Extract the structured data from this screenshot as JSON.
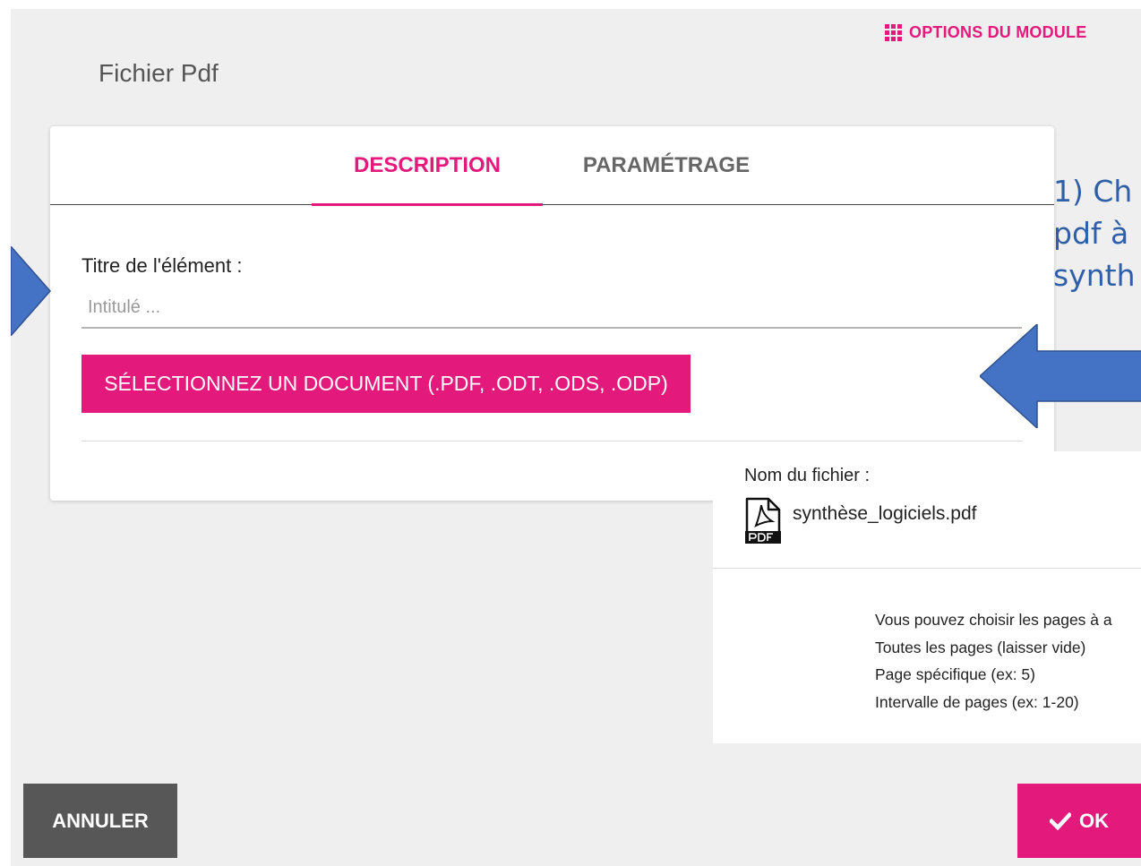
{
  "header": {
    "module_options_label": "OPTIONS DU MODULE",
    "page_title": "Fichier Pdf"
  },
  "tabs": [
    {
      "label": "DESCRIPTION",
      "active": true
    },
    {
      "label": "PARAMÉTRAGE",
      "active": false
    }
  ],
  "form": {
    "title_label": "Titre de l'élément :",
    "title_placeholder": "Intitulé ...",
    "title_value": "",
    "select_document_label": "SÉLECTIONNEZ UN DOCUMENT (.PDF, .ODT, .ODS, .ODP)"
  },
  "annotation": {
    "lines": [
      "1) Ch",
      "pdf à",
      "synth"
    ],
    "color": "#2f5fa7"
  },
  "file_panel": {
    "file_label": "Nom du fichier :",
    "file_icon": "pdf-file-icon",
    "file_name": "synthèse_logiciels.pdf",
    "page_help": [
      "Vous pouvez choisir les pages à a",
      "Toutes les pages (laisser vide)",
      "Page spécifique (ex: 5)",
      "Intervalle de pages (ex: 1-20)"
    ]
  },
  "footer": {
    "cancel_label": "ANNULER",
    "ok_label": "OK",
    "ok_icon": "checkmark-icon"
  },
  "colors": {
    "accent": "#e3197b",
    "background": "#efefef",
    "cancel_button": "#575757",
    "annotation_arrow": "#4472c4"
  }
}
